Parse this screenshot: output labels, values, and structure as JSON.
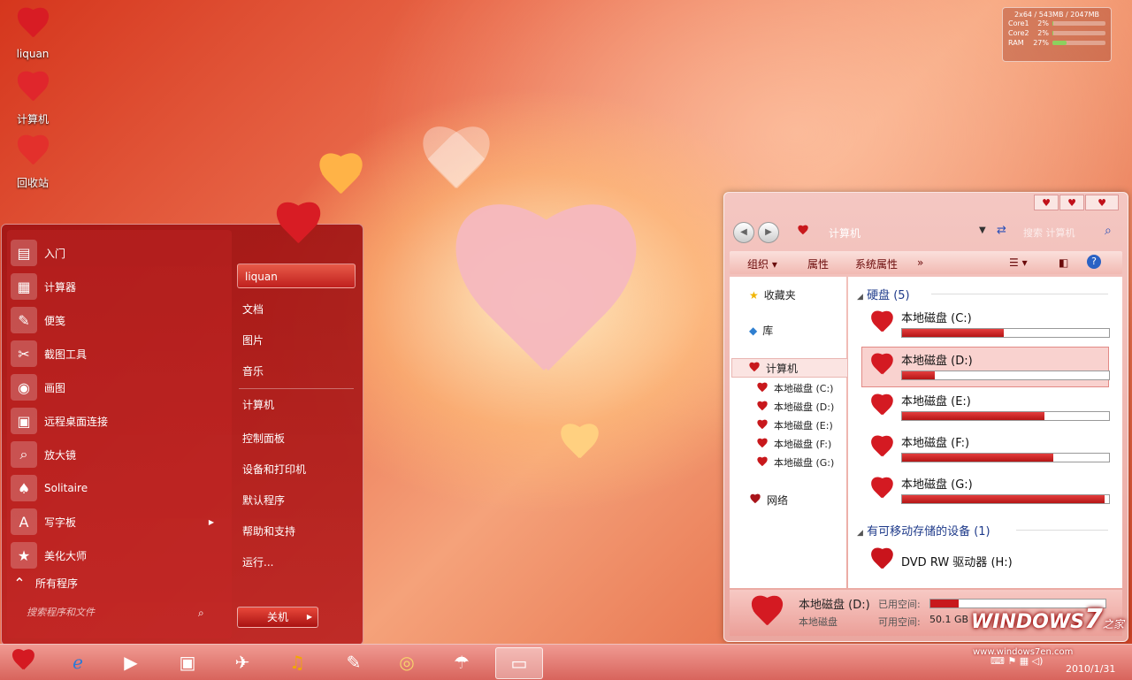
{
  "desktop": {
    "icons": [
      {
        "label": "liquan",
        "icon": "rose-heart-icon"
      },
      {
        "label": "计算机",
        "icon": "heart-computer-icon"
      },
      {
        "label": "回收站",
        "icon": "heart-recycle-icon"
      }
    ]
  },
  "gadget": {
    "header": "2x64 / 543MB / 2047MB",
    "rows": [
      {
        "name": "Core1",
        "percent": "2%",
        "value": 0.02
      },
      {
        "name": "Core2",
        "percent": "2%",
        "value": 0.02
      },
      {
        "name": "RAM",
        "percent": "27%",
        "value": 0.27
      }
    ]
  },
  "start_menu": {
    "programs": [
      {
        "label": "入门",
        "icon": "getting-started-icon"
      },
      {
        "label": "计算器",
        "icon": "calculator-icon"
      },
      {
        "label": "便笺",
        "icon": "sticky-notes-icon"
      },
      {
        "label": "截图工具",
        "icon": "snipping-tool-icon"
      },
      {
        "label": "画图",
        "icon": "paint-icon"
      },
      {
        "label": "远程桌面连接",
        "icon": "remote-desktop-icon"
      },
      {
        "label": "放大镜",
        "icon": "magnifier-icon"
      },
      {
        "label": "Solitaire",
        "icon": "solitaire-icon"
      },
      {
        "label": "写字板",
        "icon": "wordpad-icon"
      },
      {
        "label": "美化大师",
        "icon": "beautify-icon"
      }
    ],
    "all_programs": "所有程序",
    "search_placeholder": "搜索程序和文件",
    "user": "liquan",
    "right_items": [
      "文档",
      "图片",
      "音乐",
      "计算机",
      "控制面板",
      "设备和打印机",
      "默认程序",
      "帮助和支持",
      "运行..."
    ],
    "shutdown": "关机"
  },
  "explorer": {
    "address": "计算机",
    "search_placeholder": "搜索 计算机",
    "toolbar": {
      "organize": "组织",
      "properties": "属性",
      "system_properties": "系统属性",
      "more": "»"
    },
    "nav": {
      "favorites": "收藏夹",
      "libraries": "库",
      "computer": "计算机",
      "drives": [
        "本地磁盘 (C:)",
        "本地磁盘 (D:)",
        "本地磁盘 (E:)",
        "本地磁盘 (F:)",
        "本地磁盘 (G:)"
      ],
      "network": "网络"
    },
    "groups": {
      "hdd_label": "硬盘",
      "hdd_count": "(5)",
      "removable_label": "有可移动存储的设备",
      "removable_count": "(1)"
    },
    "drives": [
      {
        "name": "本地磁盘 (C:)",
        "used": 0.49
      },
      {
        "name": "本地磁盘 (D:)",
        "used": 0.16,
        "selected": true
      },
      {
        "name": "本地磁盘 (E:)",
        "used": 0.69
      },
      {
        "name": "本地磁盘 (F:)",
        "used": 0.73
      },
      {
        "name": "本地磁盘 (G:)",
        "used": 0.98
      }
    ],
    "dvd": "DVD RW 驱动器 (H:)",
    "details": {
      "name": "本地磁盘 (D:)",
      "type": "本地磁盘",
      "used_label": "已用空间:",
      "free_label": "可用空间:",
      "free_value": "50.1 GB",
      "used": 0.16
    }
  },
  "taskbar": {
    "date": "2010/1/31",
    "icons": [
      "start-heart-icon",
      "ie-icon",
      "media-player-icon",
      "network-icon",
      "tools-icon",
      "music-icon",
      "feather-icon",
      "cd-icon",
      "cleaner-icon",
      "monitor-icon"
    ]
  },
  "watermark": {
    "brand": "WINDOWS",
    "seven": "7",
    "suffix": "之家",
    "url": "www.windows7en.com"
  },
  "colors": {
    "accent": "#c8181c",
    "heart": "#e0202a",
    "link_blue": "#1e3a8a"
  }
}
